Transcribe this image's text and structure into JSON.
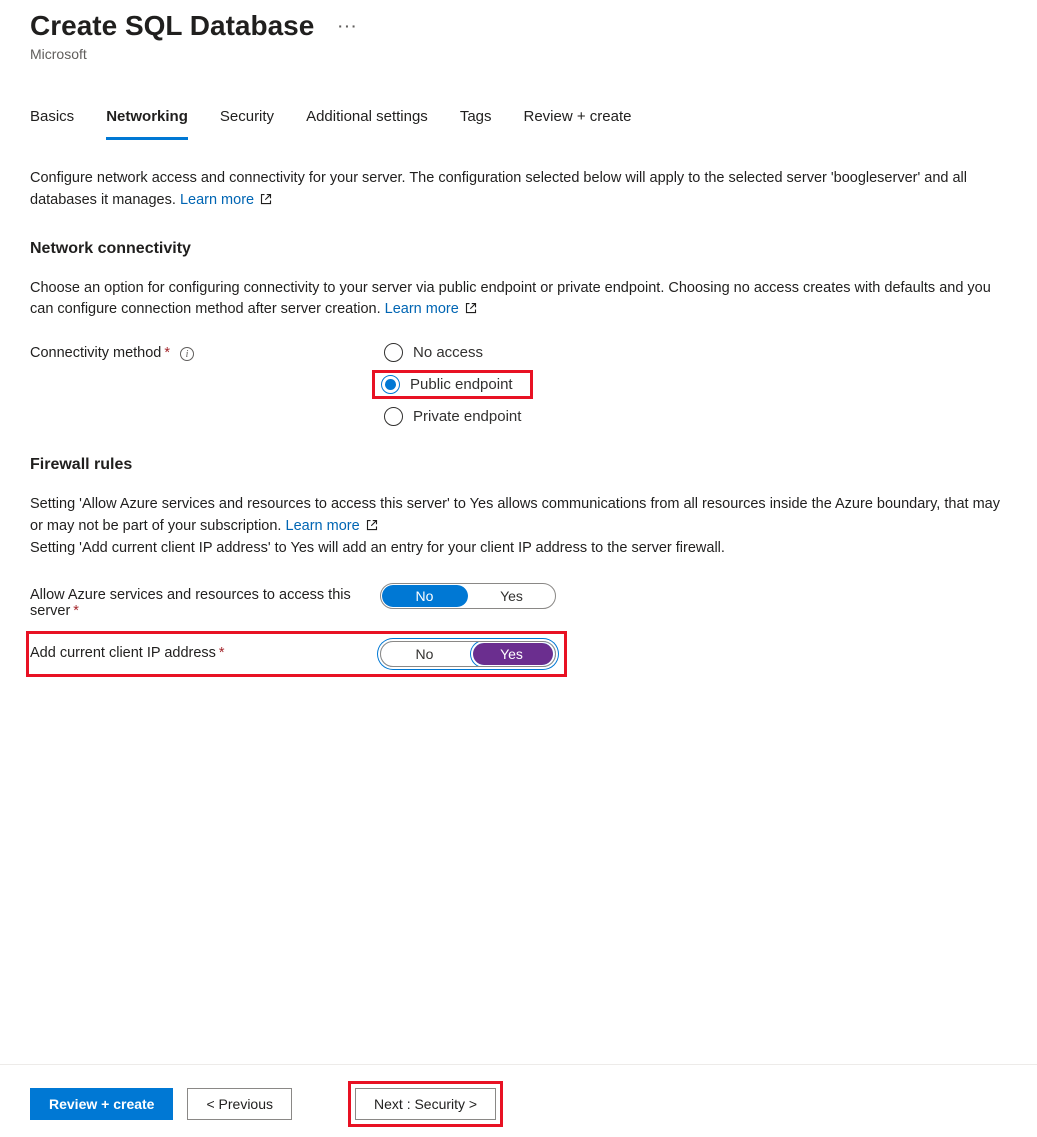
{
  "header": {
    "title": "Create SQL Database",
    "subtitle": "Microsoft"
  },
  "tabs": [
    {
      "id": "basics",
      "label": "Basics",
      "active": false
    },
    {
      "id": "networking",
      "label": "Networking",
      "active": true
    },
    {
      "id": "security",
      "label": "Security",
      "active": false
    },
    {
      "id": "additional",
      "label": "Additional settings",
      "active": false
    },
    {
      "id": "tags",
      "label": "Tags",
      "active": false
    },
    {
      "id": "review",
      "label": "Review + create",
      "active": false
    }
  ],
  "networking": {
    "intro": "Configure network access and connectivity for your server. The configuration selected below will apply to the selected server 'boogleserver' and all databases it manages.",
    "learn_more": "Learn more",
    "connectivity": {
      "title": "Network connectivity",
      "desc": "Choose an option for configuring connectivity to your server via public endpoint or private endpoint. Choosing no access creates with defaults and you can configure connection method after server creation.",
      "learn_more": "Learn more",
      "label": "Connectivity method",
      "options": [
        {
          "id": "noaccess",
          "label": "No access",
          "selected": false
        },
        {
          "id": "public",
          "label": "Public endpoint",
          "selected": true
        },
        {
          "id": "private",
          "label": "Private endpoint",
          "selected": false
        }
      ]
    },
    "firewall": {
      "title": "Firewall rules",
      "desc1": "Setting 'Allow Azure services and resources to access this server' to Yes allows communications from all resources inside the Azure boundary, that may or may not be part of your subscription.",
      "learn_more": "Learn more",
      "desc2": "Setting 'Add current client IP address' to Yes will add an entry for your client IP address to the server firewall.",
      "allowAzure": {
        "label": "Allow Azure services and resources to access this server",
        "value": "No",
        "options": {
          "no": "No",
          "yes": "Yes"
        }
      },
      "clientIp": {
        "label": "Add current client IP address",
        "value": "Yes",
        "options": {
          "no": "No",
          "yes": "Yes"
        }
      }
    }
  },
  "footer": {
    "review": "Review + create",
    "previous": "< Previous",
    "next": "Next : Security >"
  }
}
